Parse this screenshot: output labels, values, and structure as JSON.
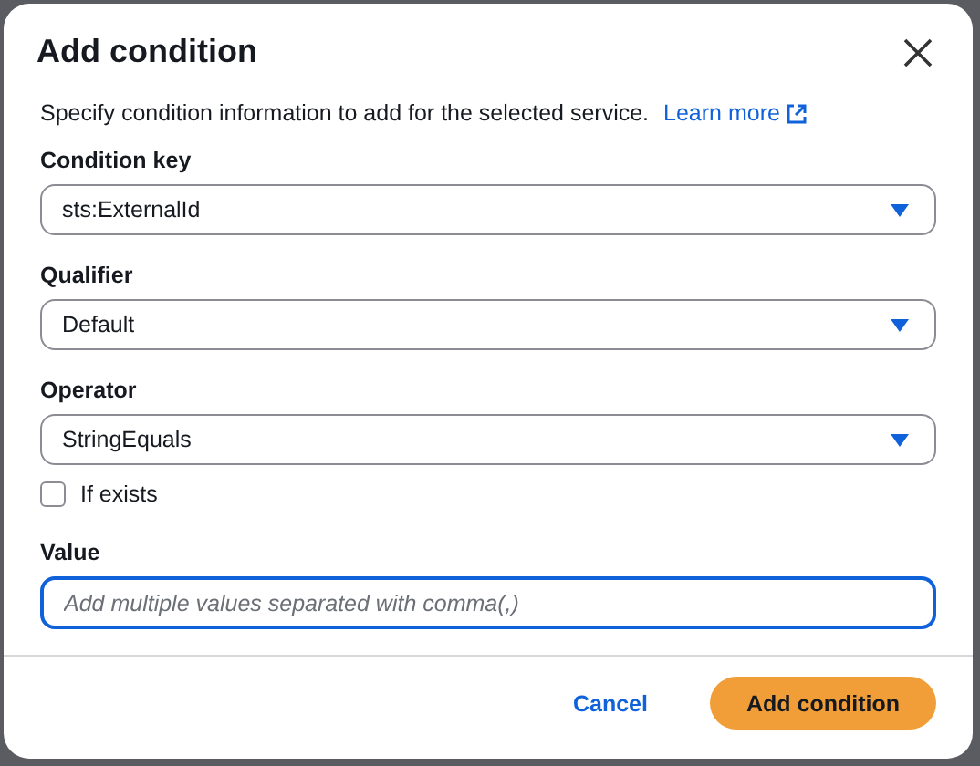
{
  "dialog": {
    "title": "Add condition",
    "description": "Specify condition information to add for the selected service.",
    "learn_more": "Learn more"
  },
  "selects": [
    {
      "label": "Condition key",
      "value": "sts:ExternalId"
    },
    {
      "label": "Qualifier",
      "value": "Default"
    },
    {
      "label": "Operator",
      "value": "StringEquals"
    }
  ],
  "if_exists": {
    "label": "If exists",
    "checked": false
  },
  "value_field": {
    "label": "Value",
    "placeholder": "Add multiple values separated with comma(,)",
    "focused": true
  },
  "buttons": [
    {
      "label": "Cancel",
      "kind": "link"
    },
    {
      "label": "Add condition",
      "kind": "primary"
    }
  ]
}
